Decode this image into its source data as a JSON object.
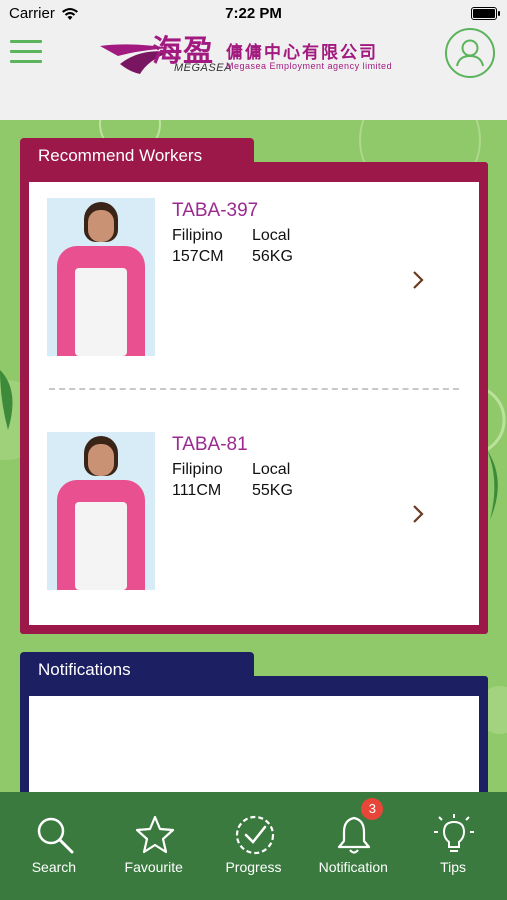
{
  "status_bar": {
    "carrier": "Carrier",
    "time": "7:22 PM",
    "battery_level": 1.0
  },
  "header": {
    "logo_cn_big": "海盈",
    "logo_brand_en": "MEGASEA",
    "logo_cn_small": "傭傭中心有限公司",
    "logo_en_name": "Megasea Employment agency limited",
    "menu_icon": "hamburger-icon",
    "profile_icon": "user-icon"
  },
  "recommend": {
    "title": "Recommend Workers",
    "workers": [
      {
        "code": "TABA-397",
        "nationality": "Filipino",
        "location": "Local",
        "height": "157CM",
        "weight": "56KG"
      },
      {
        "code": "TABA-81",
        "nationality": "Filipino",
        "location": "Local",
        "height": "111CM",
        "weight": "55KG"
      }
    ]
  },
  "notifications": {
    "title": "Notifications"
  },
  "tabbar": {
    "items": [
      {
        "label": "Search",
        "icon": "search-icon"
      },
      {
        "label": "Favourite",
        "icon": "star-icon"
      },
      {
        "label": "Progress",
        "icon": "check-circle-icon"
      },
      {
        "label": "Notification",
        "icon": "bell-icon",
        "badge": "3"
      },
      {
        "label": "Tips",
        "icon": "lightbulb-icon"
      }
    ]
  },
  "colors": {
    "accent_green": "#5bb35b",
    "brand_magenta": "#a21a7f",
    "recommend_frame": "#9c1848",
    "notification_frame": "#1d1f63",
    "tabbar_bg": "#3a7a3e",
    "badge_red": "#e9463a"
  }
}
